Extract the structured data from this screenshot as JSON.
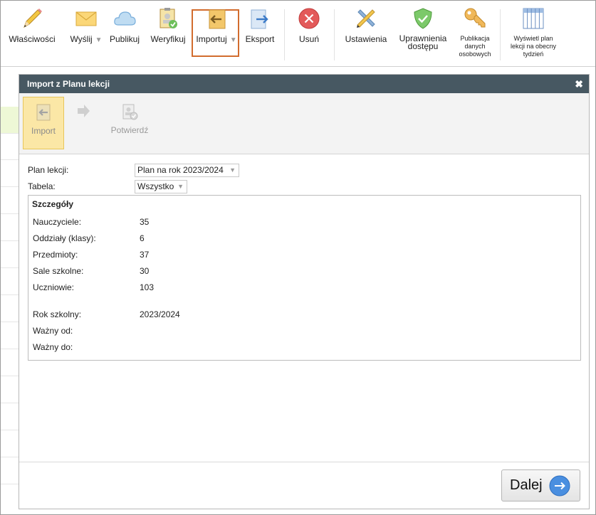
{
  "ribbon": {
    "items": [
      {
        "label": "Właściwości",
        "icon": "pencil-icon"
      },
      {
        "label": "Wyślij",
        "icon": "envelope-icon",
        "has_dropdown": true
      },
      {
        "label": "Publikuj",
        "icon": "cloud-icon"
      },
      {
        "label": "Weryfikuj",
        "icon": "checklist-icon"
      },
      {
        "label": "Importuj",
        "icon": "import-arrow-icon",
        "has_dropdown": true,
        "highlighted": true
      },
      {
        "label": "Eksport",
        "icon": "export-arrow-icon"
      },
      {
        "label": "Usuń",
        "icon": "delete-icon"
      },
      {
        "label": "Ustawienia",
        "icon": "settings-tools-icon"
      },
      {
        "label": "Uprawnienia dostępu",
        "icon": "shield-check-icon"
      },
      {
        "label": "Publikacja danych osobowych",
        "icon": "key-icon"
      },
      {
        "label": "Wyświetl plan lekcji na obecny tydzień",
        "icon": "calendar-grid-icon"
      }
    ],
    "dropdown_glyph": "▼"
  },
  "dialog": {
    "title": "Import z Planu lekcji",
    "close_glyph": "✖",
    "wizard": {
      "steps": [
        {
          "label": "Import",
          "icon": "import-step-icon",
          "active": true
        },
        {
          "label": "",
          "icon": "next-step-arrow-icon"
        },
        {
          "label": "Potwierdź",
          "icon": "confirm-step-icon",
          "active": false
        }
      ]
    },
    "form": {
      "plan_label": "Plan lekcji:",
      "plan_value": "Plan na rok 2023/2024",
      "table_label": "Tabela:",
      "table_value": "Wszystko"
    },
    "details": {
      "title": "Szczegóły",
      "rows": [
        {
          "label": "Nauczyciele:",
          "value": "35"
        },
        {
          "label": "Oddziały (klasy):",
          "value": "6"
        },
        {
          "label": "Przedmioty:",
          "value": "37"
        },
        {
          "label": "Sale szkolne:",
          "value": "30"
        },
        {
          "label": "Uczniowie:",
          "value": "103"
        },
        {
          "label": "Rok szkolny:",
          "value": "2023/2024"
        },
        {
          "label": "Ważny od:",
          "value": ""
        },
        {
          "label": "Ważny do:",
          "value": ""
        }
      ]
    },
    "next_button": "Dalej"
  },
  "colors": {
    "title_bar": "#475862",
    "import_highlight": "#d26c2e",
    "active_step_bg": "#fbe7a6",
    "next_circle": "#4a8fe0"
  }
}
